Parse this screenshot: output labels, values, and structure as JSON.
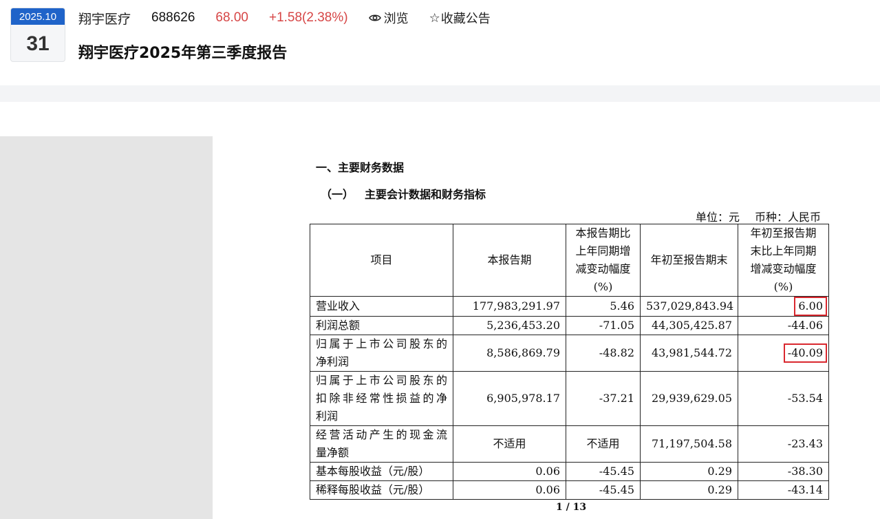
{
  "header": {
    "date_month": "2025.10",
    "date_day": "31",
    "stock_name": "翔宇医疗",
    "stock_code": "688626",
    "price": "68.00",
    "change": "+1.58(2.38%)",
    "view_label": "浏览",
    "favorite_label": "收藏公告",
    "report_title": "翔宇医疗2025年第三季度报告"
  },
  "colors": {
    "accent": "#1f63c9",
    "up": "#d64545",
    "highlight_box": "#d9272e"
  },
  "icons": {
    "view": "eye-icon",
    "favorite": "star-icon"
  },
  "document": {
    "section_title": "一、主要财务数据",
    "sub_paren": "（一）",
    "sub_title": "主要会计数据和财务指标",
    "unit": "单位：元",
    "currency": "币种：人民币",
    "table": {
      "headers": [
        "项目",
        "本报告期",
        "本报告期比上年同期增减变动幅度(%)",
        "年初至报告期末",
        "年初至报告期末比上年同期增减变动幅度(%)"
      ],
      "header_lines": [
        [
          "项目"
        ],
        [
          "本报告期"
        ],
        [
          "本报告期比",
          "上年同期增",
          "减变动幅度",
          "(%)"
        ],
        [
          "年初至报告期末"
        ],
        [
          "年初至报告期",
          "末比上年同期",
          "增减变动幅度",
          "(%)"
        ]
      ],
      "rows": [
        {
          "item": [
            "营业收入"
          ],
          "current": "177,983,291.97",
          "current_change": "5.46",
          "ytd": "537,029,843.94",
          "ytd_change": "6.00"
        },
        {
          "item": [
            "利润总额"
          ],
          "current": "5,236,453.20",
          "current_change": "-71.05",
          "ytd": "44,305,425.87",
          "ytd_change": "-44.06"
        },
        {
          "item": [
            "归属于上市公司股东的",
            "净利润"
          ],
          "current": "8,586,869.79",
          "current_change": "-48.82",
          "ytd": "43,981,544.72",
          "ytd_change": "-40.09"
        },
        {
          "item": [
            "归属于上市公司股东的",
            "扣除非经常性损益的净",
            "利润"
          ],
          "current": "6,905,978.17",
          "current_change": "-37.21",
          "ytd": "29,939,629.05",
          "ytd_change": "-53.54"
        },
        {
          "item": [
            "经营活动产生的现金流",
            "量净额"
          ],
          "current": "不适用",
          "current_change": "不适用",
          "ytd": "71,197,504.58",
          "ytd_change": "-23.43"
        },
        {
          "item": [
            "基本每股收益（元/股）"
          ],
          "current": "0.06",
          "current_change": "-45.45",
          "ytd": "0.29",
          "ytd_change": "-38.30"
        },
        {
          "item": [
            "稀释每股收益（元/股）"
          ],
          "current": "0.06",
          "current_change": "-45.45",
          "ytd": "0.29",
          "ytd_change": "-43.14"
        }
      ]
    },
    "page_indicator": "1 / 13"
  }
}
